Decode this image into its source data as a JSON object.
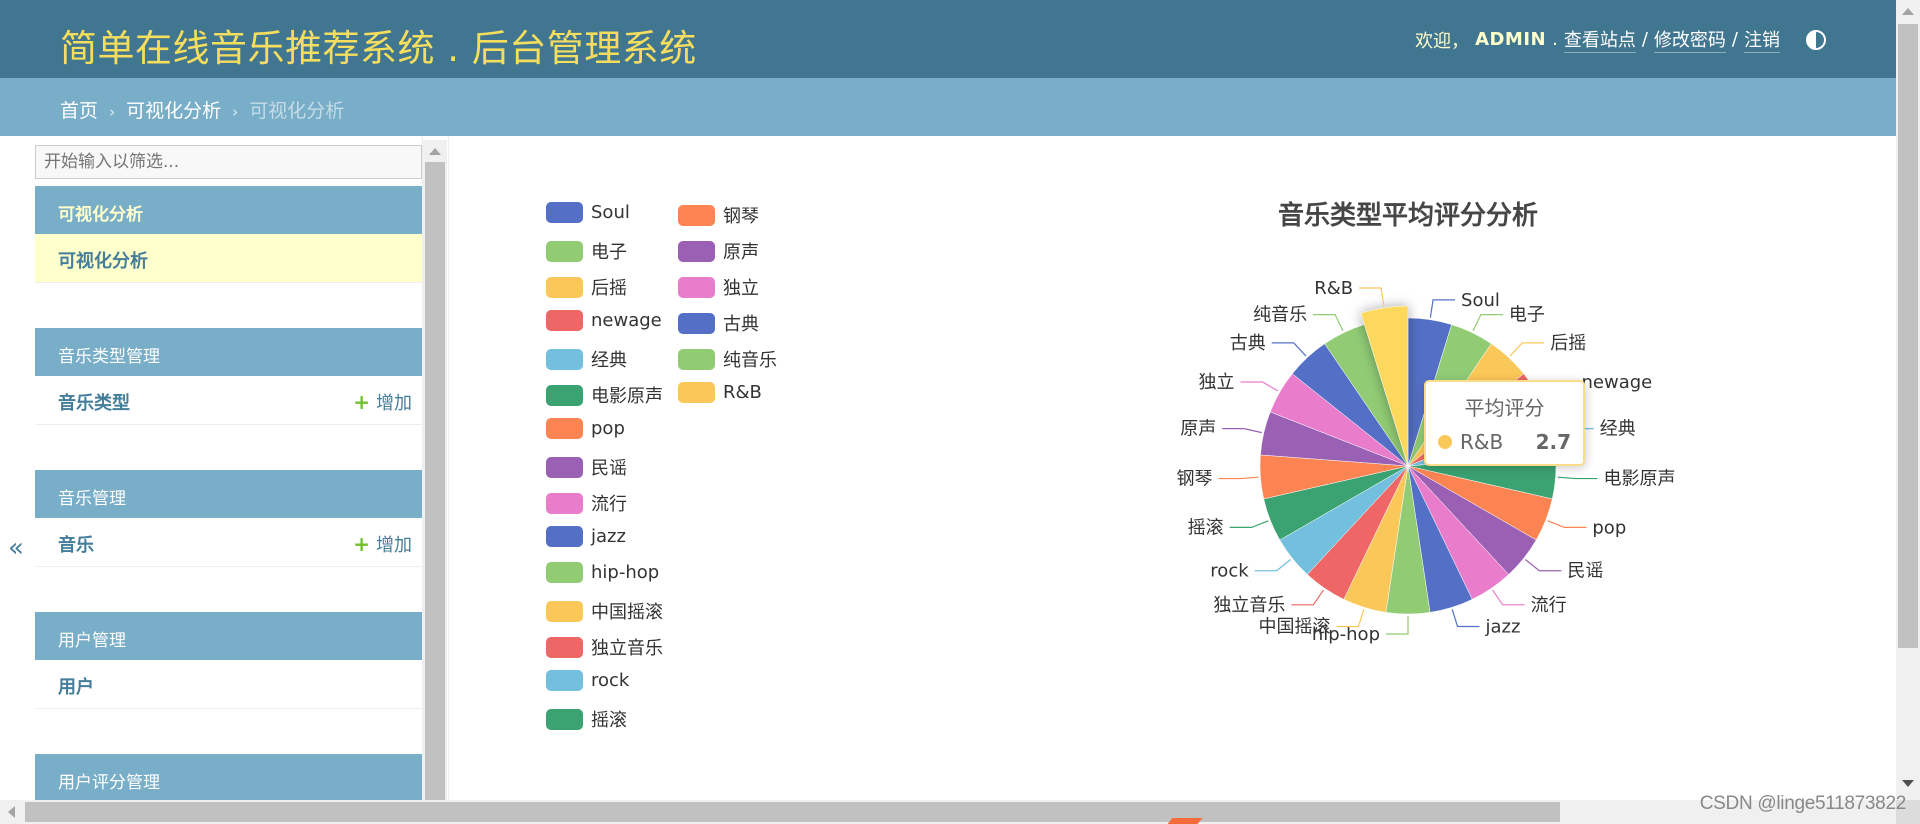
{
  "header": {
    "brand": "简单在线音乐推荐系统 . 后台管理系统",
    "welcome": "欢迎，",
    "username": "ADMIN",
    "view_site": "查看站点",
    "change_password": "修改密码",
    "logout": "注销",
    "separator": "/"
  },
  "breadcrumbs": {
    "home": "首页",
    "section": "可视化分析",
    "current": "可视化分析",
    "separator": "›"
  },
  "sidebar": {
    "filter_placeholder": "开始输入以筛选...",
    "collapse_label": "«",
    "add_label": "增加",
    "add_icon": "+",
    "modules": [
      {
        "caption": "可视化分析",
        "items": [
          {
            "label": "可视化分析",
            "current": true,
            "add": false
          }
        ]
      },
      {
        "caption": "音乐类型管理",
        "items": [
          {
            "label": "音乐类型",
            "current": false,
            "add": true
          }
        ]
      },
      {
        "caption": "音乐管理",
        "items": [
          {
            "label": "音乐",
            "current": false,
            "add": true
          }
        ]
      },
      {
        "caption": "用户管理",
        "items": [
          {
            "label": "用户",
            "current": false,
            "add": false
          }
        ]
      },
      {
        "caption": "用户评分管理",
        "items": []
      }
    ]
  },
  "chart_data": {
    "type": "pie",
    "rose_type": "area",
    "title": "音乐类型平均评分分析",
    "series_name": "平均评分",
    "legend_position": "top-left",
    "categories": [
      "Soul",
      "电子",
      "后摇",
      "newage",
      "经典",
      "电影原声",
      "pop",
      "民谣",
      "流行",
      "jazz",
      "hip-hop",
      "中国摇滚",
      "独立音乐",
      "rock",
      "摇滚",
      "钢琴",
      "原声",
      "独立",
      "古典",
      "纯音乐",
      "R&B"
    ],
    "values": [
      2.7,
      2.7,
      2.7,
      2.7,
      2.7,
      2.7,
      2.7,
      2.7,
      2.7,
      2.7,
      2.7,
      2.7,
      2.7,
      2.7,
      2.7,
      2.7,
      2.7,
      2.7,
      2.7,
      2.7,
      2.7
    ],
    "colors": [
      "#5470c6",
      "#91cc75",
      "#fac858",
      "#ee6666",
      "#73c0de",
      "#3ba272",
      "#fc8452",
      "#9a60b4",
      "#ea7ccc",
      "#5470c6",
      "#91cc75",
      "#fac858",
      "#ee6666",
      "#73c0de",
      "#3ba272",
      "#fc8452",
      "#9a60b4",
      "#ea7ccc",
      "#5470c6",
      "#91cc75",
      "#fac858"
    ],
    "highlighted": "R&B",
    "tooltip": {
      "title": "平均评分",
      "name": "R&B",
      "value": "2.7"
    }
  },
  "watermark": "CSDN @linge511873822"
}
